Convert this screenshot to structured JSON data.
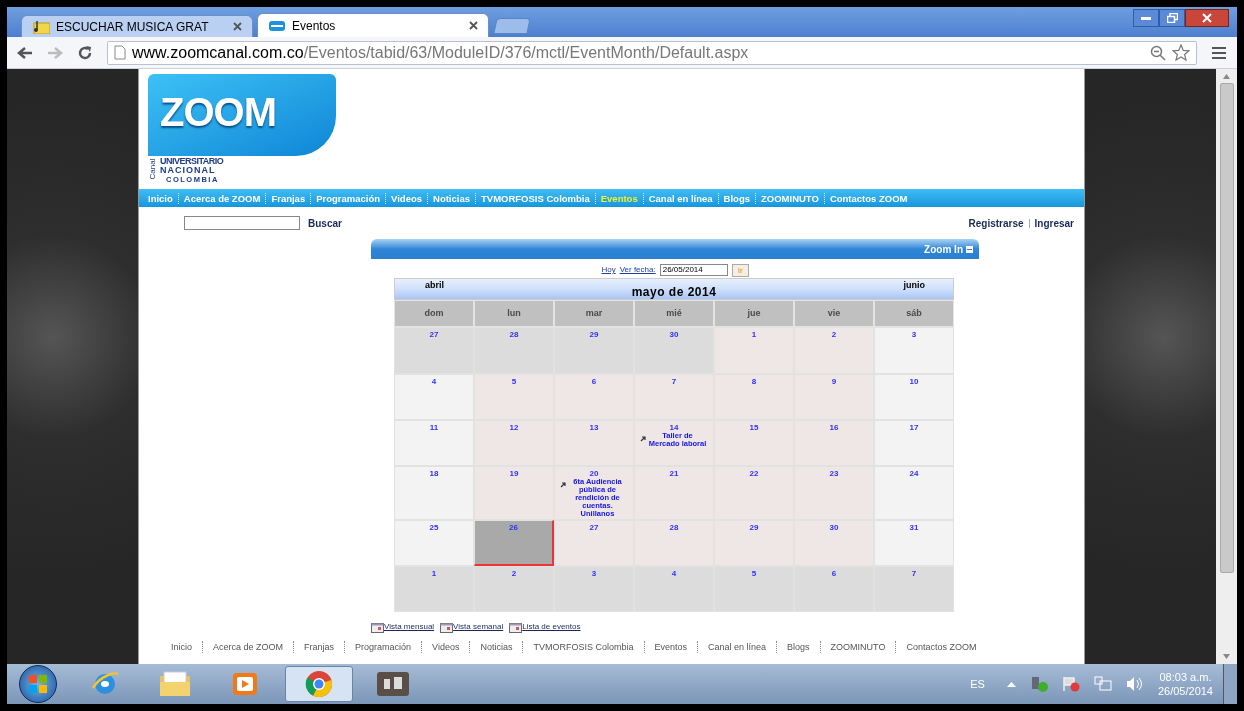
{
  "browser": {
    "tabs": [
      {
        "title": "ESCUCHAR MUSICA GRAT",
        "selected": false
      },
      {
        "title": "Eventos",
        "selected": true
      }
    ],
    "url": {
      "host": "www.zoomcanal.com.co",
      "path": "/Eventos/tabid/63/ModuleID/376/mctl/EventMonth/Default.aspx"
    }
  },
  "logo": {
    "word": "ZOOM",
    "canal": "Canal",
    "line1": "UNIVERSITARIO",
    "line2": "NACIONAL",
    "line3": "COLOMBIA"
  },
  "nav": [
    {
      "label": "Inicio",
      "selected": false
    },
    {
      "label": "Acerca de ZOOM",
      "selected": false
    },
    {
      "label": "Franjas",
      "selected": false
    },
    {
      "label": "Programación",
      "selected": false
    },
    {
      "label": "Videos",
      "selected": false
    },
    {
      "label": "Noticias",
      "selected": false
    },
    {
      "label": "TVMORFOSIS Colombia",
      "selected": false
    },
    {
      "label": "Eventos",
      "selected": true
    },
    {
      "label": "Canal en línea",
      "selected": false
    },
    {
      "label": "Blogs",
      "selected": false
    },
    {
      "label": "ZOOMINUTO",
      "selected": false
    },
    {
      "label": "Contactos ZOOM",
      "selected": false
    }
  ],
  "search": {
    "button": "Buscar"
  },
  "account_links": [
    "Registrarse",
    "Ingresar"
  ],
  "module": {
    "title": "Zoom In"
  },
  "calendar": {
    "today_link": "Hoy",
    "date_label": "Ver fecha:",
    "date_value": "26/05/2014",
    "go_button": "Ir",
    "prev_month": "abril",
    "next_month": "junio",
    "title": "mayo de 2014",
    "weekdays": [
      "dom",
      "lun",
      "mar",
      "mié",
      "jue",
      "vie",
      "sáb"
    ],
    "weeks": [
      [
        {
          "day": "27",
          "kind": "other"
        },
        {
          "day": "28",
          "kind": "other"
        },
        {
          "day": "29",
          "kind": "other"
        },
        {
          "day": "30",
          "kind": "other"
        },
        {
          "day": "1",
          "kind": "weekday"
        },
        {
          "day": "2",
          "kind": "weekday"
        },
        {
          "day": "3",
          "kind": "weekend"
        }
      ],
      [
        {
          "day": "4",
          "kind": "weekend"
        },
        {
          "day": "5",
          "kind": "weekday"
        },
        {
          "day": "6",
          "kind": "weekday"
        },
        {
          "day": "7",
          "kind": "weekday"
        },
        {
          "day": "8",
          "kind": "weekday"
        },
        {
          "day": "9",
          "kind": "weekday"
        },
        {
          "day": "10",
          "kind": "weekend"
        }
      ],
      [
        {
          "day": "11",
          "kind": "weekend"
        },
        {
          "day": "12",
          "kind": "weekday"
        },
        {
          "day": "13",
          "kind": "weekday"
        },
        {
          "day": "14",
          "kind": "weekday",
          "events": [
            "Taller de Mercado laboral"
          ]
        },
        {
          "day": "15",
          "kind": "weekday"
        },
        {
          "day": "16",
          "kind": "weekday"
        },
        {
          "day": "17",
          "kind": "weekend"
        }
      ],
      [
        {
          "day": "18",
          "kind": "weekend"
        },
        {
          "day": "19",
          "kind": "weekday"
        },
        {
          "day": "20",
          "kind": "weekday",
          "events": [
            "6ta Audiencia pública de rendición de cuentas. Unillanos"
          ]
        },
        {
          "day": "21",
          "kind": "weekday"
        },
        {
          "day": "22",
          "kind": "weekday"
        },
        {
          "day": "23",
          "kind": "weekday"
        },
        {
          "day": "24",
          "kind": "weekend"
        }
      ],
      [
        {
          "day": "25",
          "kind": "weekend"
        },
        {
          "day": "26",
          "kind": "today"
        },
        {
          "day": "27",
          "kind": "weekday"
        },
        {
          "day": "28",
          "kind": "weekday"
        },
        {
          "day": "29",
          "kind": "weekday"
        },
        {
          "day": "30",
          "kind": "weekday"
        },
        {
          "day": "31",
          "kind": "weekend"
        }
      ],
      [
        {
          "day": "1",
          "kind": "other"
        },
        {
          "day": "2",
          "kind": "other"
        },
        {
          "day": "3",
          "kind": "other"
        },
        {
          "day": "4",
          "kind": "other"
        },
        {
          "day": "5",
          "kind": "other"
        },
        {
          "day": "6",
          "kind": "other"
        },
        {
          "day": "7",
          "kind": "other"
        }
      ]
    ]
  },
  "view_links": [
    "Vista mensual",
    "Vista semanal",
    "Lista de eventos"
  ],
  "footer_nav": [
    "Inicio",
    "Acerca de ZOOM",
    "Franjas",
    "Programación",
    "Videos",
    "Noticias",
    "TVMORFOSIS Colombia",
    "Eventos",
    "Canal en línea",
    "Blogs",
    "ZOOMINUTO",
    "Contactos ZOOM"
  ],
  "taskbar": {
    "language": "ES",
    "time": "08:03 a.m.",
    "date": "26/05/2014"
  }
}
